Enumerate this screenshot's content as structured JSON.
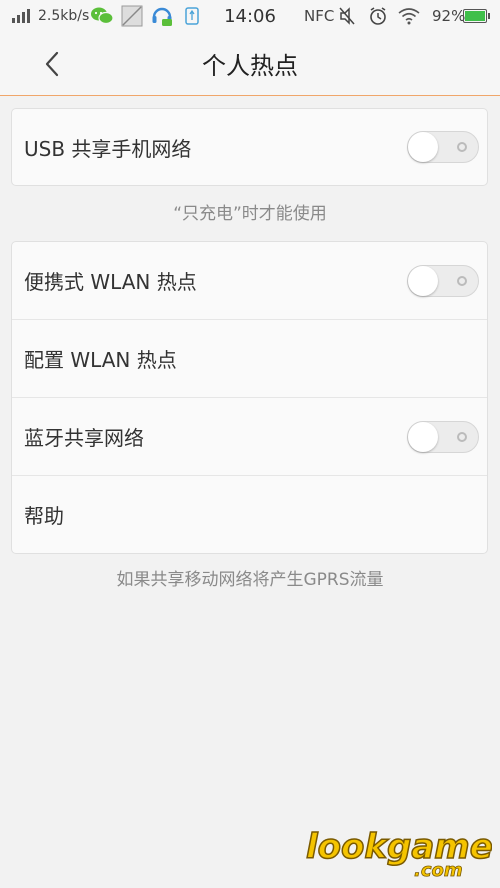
{
  "status_bar": {
    "speed": "2.5kb/s",
    "time": "14:06",
    "nfc": "NFC",
    "battery": "92%",
    "icons": [
      "signal-icon",
      "wechat-icon",
      "image-icon",
      "headset-icon",
      "usb-icon",
      "mute-icon",
      "alarm-icon",
      "wifi-icon",
      "battery-icon"
    ]
  },
  "header": {
    "title": "个人热点",
    "back_icon": "chevron-left-icon"
  },
  "usb_card": {
    "label": "USB 共享手机网络",
    "toggle_on": false
  },
  "usb_hint": "“只充电”时才能使用",
  "settings": {
    "wlan_hotspot": {
      "label": "便携式 WLAN 热点",
      "toggle_on": false
    },
    "config_wlan": {
      "label": "配置 WLAN 热点"
    },
    "bt_tethering": {
      "label": "蓝牙共享网络",
      "toggle_on": false
    },
    "help": {
      "label": "帮助"
    }
  },
  "footer_hint": "如果共享移动网络将产生GPRS流量",
  "watermark": {
    "text": "lookgame",
    "suffix": ".com"
  },
  "colors": {
    "accent_line": "#f0a66a",
    "background": "#f2f2f2",
    "watermark": "#f5c400"
  }
}
